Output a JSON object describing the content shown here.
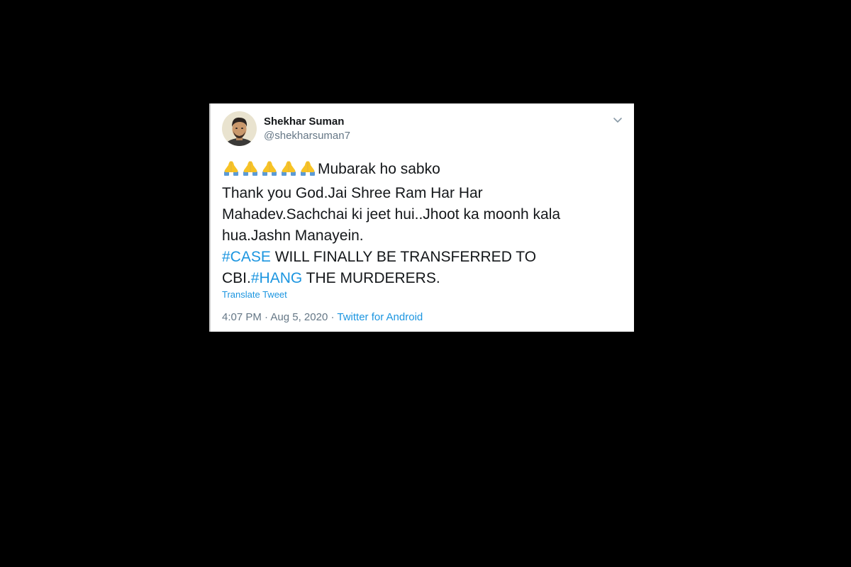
{
  "colors": {
    "background": "#000000",
    "card": "#ffffff",
    "link": "#1b95e0",
    "text": "#14171a",
    "muted": "#657786"
  },
  "author": {
    "display_name": "Shekhar Suman",
    "handle": "@shekharsuman7",
    "avatar_icon": "avatar-photo"
  },
  "tweet": {
    "emoji_icon": "folded-hands-emoji",
    "emoji_count": 5,
    "line1_text": "Mubarak ho sabko",
    "line2_text": "Thank you God.Jai Shree Ram Har Har",
    "line3_text": "Mahadev.Sachchai ki jeet hui..Jhoot ka moonh kala",
    "line4_text": "hua.Jashn Manayein.",
    "hashtag1": "#CASE",
    "line5_rest": " WILL FINALLY BE TRANSFERRED TO",
    "line6_prefix": "CBI.",
    "hashtag2": "#HANG",
    "line6_rest": " THE MURDERERS."
  },
  "translate_label": "Translate Tweet",
  "meta": {
    "time": "4:07 PM",
    "separator1": " · ",
    "date": "Aug 5, 2020",
    "separator2": " · ",
    "source": "Twitter for Android"
  },
  "menu_icon": "chevron-down-icon"
}
